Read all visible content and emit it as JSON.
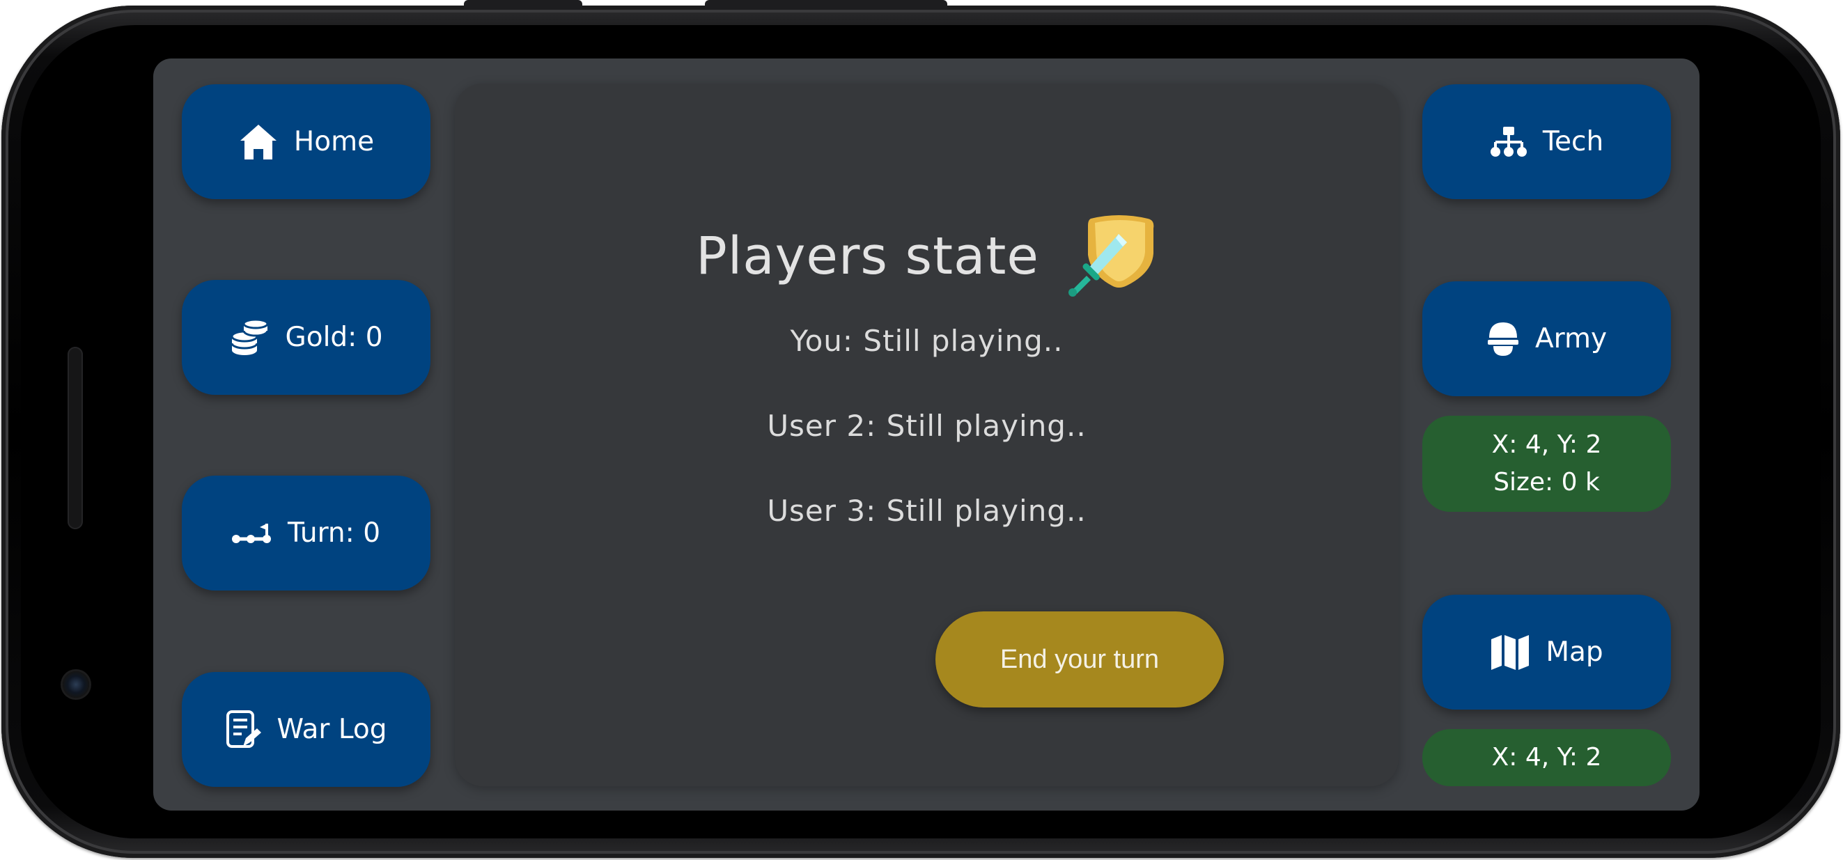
{
  "left_nav": {
    "home_label": "Home",
    "gold_label": "Gold: 0",
    "turn_label": "Turn: 0",
    "warlog_label": "War Log"
  },
  "right_nav": {
    "tech_label": "Tech",
    "army_label": "Army",
    "army_position": "X: 4, Y: 2",
    "army_size": "Size: 0 k",
    "map_label": "Map",
    "map_position": "X: 4, Y: 2"
  },
  "main": {
    "title": "Players state",
    "players": [
      "You: Still playing..",
      "User 2: Still playing..",
      "User 3: Still playing.."
    ],
    "end_turn_label": "End your turn"
  },
  "icons": {
    "home": "home-icon",
    "gold": "coins-icon",
    "turn": "turn-track-icon",
    "warlog": "log-edit-icon",
    "tech": "tech-tree-icon",
    "army": "helmet-icon",
    "map": "map-icon",
    "title": "shield-sword-icon"
  },
  "colors": {
    "nav_button": "#004380",
    "info_pill": "#265f30",
    "end_turn": "#a6881e",
    "screen_bg": "#3c3f43",
    "panel_bg": "#36383b"
  }
}
